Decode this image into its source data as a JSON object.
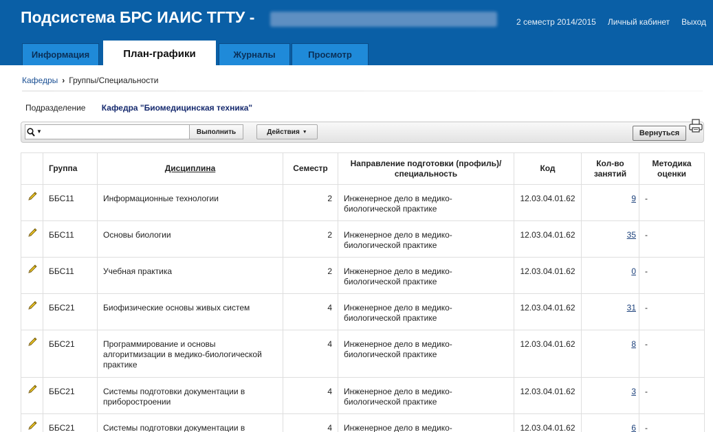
{
  "header": {
    "app_title": "Подсистема БРС ИАИС ТГТУ -",
    "semester": "2 семестр 2014/2015",
    "cabinet": "Личный кабинет",
    "logout": "Выход"
  },
  "tabs": [
    {
      "label": "Информация",
      "active": false
    },
    {
      "label": "План-графики",
      "active": true
    },
    {
      "label": "Журналы",
      "active": false
    },
    {
      "label": "Просмотр",
      "active": false
    }
  ],
  "breadcrumb": {
    "parent": "Кафедры",
    "separator": "›",
    "current": "Группы/Специальности"
  },
  "division": {
    "label": "Подразделение",
    "value": "Кафедра \"Биомедицинская техника\""
  },
  "toolbar": {
    "search_value": "",
    "go_label": "Выполнить",
    "actions_label": "Действия",
    "back_label": "Вернуться"
  },
  "table": {
    "columns": [
      "",
      "Группа",
      "Дисциплина",
      "Семестр",
      "Направление подготовки (профиль)/специальность",
      "Код",
      "Кол-во занятий",
      "Методика оценки"
    ],
    "rows": [
      {
        "group": "ББС11",
        "discipline": "Информационные технологии",
        "semester": "2",
        "direction": "Инженерное дело в медико-биологической практике",
        "code": "12.03.04.01.62",
        "count": "9",
        "method": "-"
      },
      {
        "group": "ББС11",
        "discipline": "Основы биологии",
        "semester": "2",
        "direction": "Инженерное дело в медико-биологической практике",
        "code": "12.03.04.01.62",
        "count": "35",
        "method": "-"
      },
      {
        "group": "ББС11",
        "discipline": "Учебная практика",
        "semester": "2",
        "direction": "Инженерное дело в медико-биологической практике",
        "code": "12.03.04.01.62",
        "count": "0",
        "method": "-"
      },
      {
        "group": "ББС21",
        "discipline": "Биофизические основы живых систем",
        "semester": "4",
        "direction": "Инженерное дело в медико-биологической практике",
        "code": "12.03.04.01.62",
        "count": "31",
        "method": "-"
      },
      {
        "group": "ББС21",
        "discipline": "Программирование и основы алгоритмизации в медико-биологической практике",
        "semester": "4",
        "direction": "Инженерное дело в медико-биологической практике",
        "code": "12.03.04.01.62",
        "count": "8",
        "method": "-"
      },
      {
        "group": "ББС21",
        "discipline": "Системы подготовки документации в приборостроении",
        "semester": "4",
        "direction": "Инженерное дело в медико-биологической практике",
        "code": "12.03.04.01.62",
        "count": "3",
        "method": "-"
      },
      {
        "group": "ББС21",
        "discipline": "Системы подготовки документации в",
        "semester": "4",
        "direction": "Инженерное дело в медико-",
        "code": "12.03.04.01.62",
        "count": "6",
        "method": "-"
      }
    ]
  },
  "colors": {
    "header_bg": "#0a5fa6",
    "tab_bg": "#1f8ad9",
    "link": "#1a4f93",
    "division_value": "#162a6e"
  },
  "icons": {
    "edit": "pencil-icon",
    "print": "printer-icon",
    "search": "search-icon"
  }
}
